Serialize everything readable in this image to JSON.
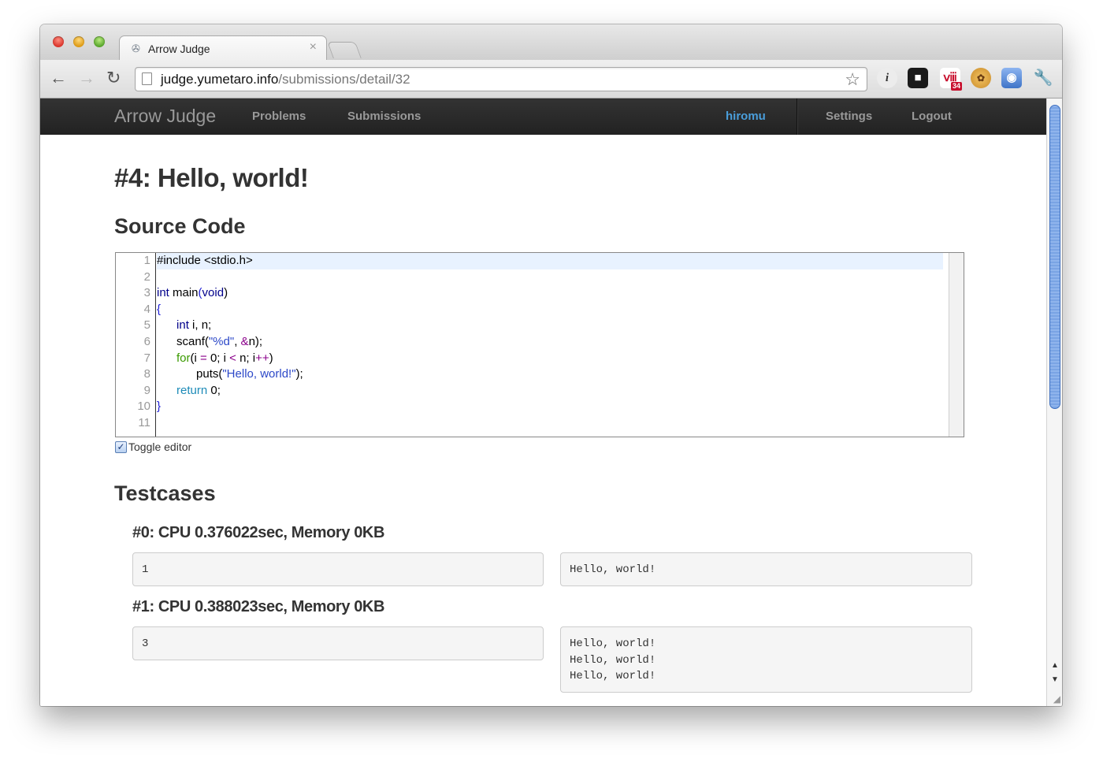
{
  "browser": {
    "tab_title": "Arrow Judge",
    "tab_close": "×",
    "url_host": "judge.yumetaro.info",
    "url_path": "/submissions/detail/32",
    "back_icon": "←",
    "forward_icon": "→",
    "reload_icon": "↻",
    "star_icon": "☆",
    "extensions": {
      "info": "i",
      "shield": "■",
      "calendar": "ⅷ",
      "calendar_badge": "34",
      "cookie": "✿",
      "target": "◉",
      "wrench": "🔧"
    }
  },
  "navbar": {
    "brand": "Arrow Judge",
    "links": [
      "Problems",
      "Submissions"
    ],
    "user": "hiromu",
    "settings": "Settings",
    "logout": "Logout"
  },
  "page": {
    "title": "#4: Hello, world!",
    "source_heading": "Source Code",
    "testcases_heading": "Testcases",
    "toggle_label": "Toggle editor",
    "toggle_checked": "✓"
  },
  "editor": {
    "line_numbers": [
      "1",
      "2",
      "3",
      "4",
      "5",
      "6",
      "7",
      "8",
      "9",
      "10",
      "11"
    ],
    "lines": [
      "#include <stdio.h>",
      "",
      "int main(void)",
      "{",
      "      int i, n;",
      "      scanf(\"%d\", &n);",
      "      for(i = 0; i < n; i++)",
      "            puts(\"Hello, world!\");",
      "      return 0;",
      "}",
      ""
    ]
  },
  "testcases": [
    {
      "title": "#0: CPU 0.376022sec, Memory 0KB",
      "input": "1",
      "output": "Hello, world!"
    },
    {
      "title": "#1: CPU 0.388023sec, Memory 0KB",
      "input": "3",
      "output": "Hello, world!\nHello, world!\nHello, world!"
    }
  ],
  "colors": {
    "navbar_bg": "#222222",
    "user_link": "#4a9edb",
    "keyword": "#00008b",
    "string": "#2c48c8"
  }
}
